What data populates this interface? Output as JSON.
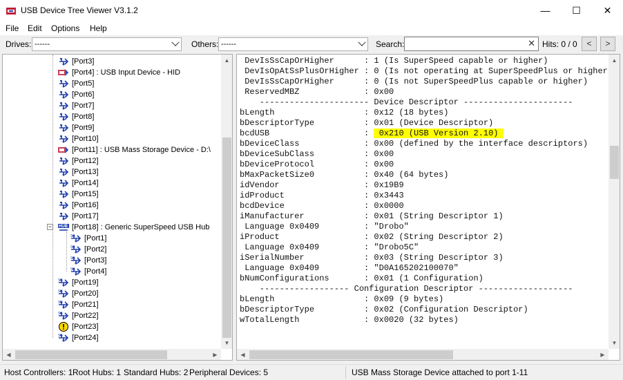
{
  "window": {
    "title": "USB Device Tree Viewer V3.1.2",
    "minimize": "—",
    "maximize": "☐",
    "close": "✕"
  },
  "menu": [
    "File",
    "Edit",
    "Options",
    "Help"
  ],
  "toolbar": {
    "drives_label": "Drives:",
    "drives_value": "------",
    "others_label": "Others:",
    "others_value": "------",
    "search_label": "Search:",
    "search_value": "",
    "search_clear": "✕",
    "hits": "Hits:  0 / 0",
    "prev": "<",
    "next": ">"
  },
  "tree": [
    {
      "label": "[Port3]",
      "icon": "usb-port-icon",
      "depth": 0
    },
    {
      "label": "[Port4] : USB Input Device - HID",
      "icon": "usb-device-icon",
      "depth": 0
    },
    {
      "label": "[Port5]",
      "icon": "usb-port-icon",
      "depth": 0
    },
    {
      "label": "[Port6]",
      "icon": "usb-port-icon",
      "depth": 0
    },
    {
      "label": "[Port7]",
      "icon": "usb-port-icon",
      "depth": 0
    },
    {
      "label": "[Port8]",
      "icon": "usb-port-icon",
      "depth": 0
    },
    {
      "label": "[Port9]",
      "icon": "usb-port-icon",
      "depth": 0
    },
    {
      "label": "[Port10]",
      "icon": "usb-port-icon",
      "depth": 0
    },
    {
      "label": "[Port11] : USB Mass Storage Device - D:\\",
      "icon": "usb-device-icon",
      "depth": 0
    },
    {
      "label": "[Port12]",
      "icon": "usb-port-icon",
      "depth": 0
    },
    {
      "label": "[Port13]",
      "icon": "usb-port-icon",
      "depth": 0
    },
    {
      "label": "[Port14]",
      "icon": "usb-port-icon",
      "depth": 0
    },
    {
      "label": "[Port15]",
      "icon": "usb-port-icon",
      "depth": 0
    },
    {
      "label": "[Port16]",
      "icon": "usb-port-icon",
      "depth": 0
    },
    {
      "label": "[Port17]",
      "icon": "usb-port-icon",
      "depth": 0
    },
    {
      "label": "[Port18] : Generic SuperSpeed USB Hub",
      "icon": "usb-hub-icon",
      "depth": 0
    },
    {
      "label": "[Port1]",
      "icon": "superspeed-port-icon",
      "depth": 1
    },
    {
      "label": "[Port2]",
      "icon": "superspeed-port-icon",
      "depth": 1
    },
    {
      "label": "[Port3]",
      "icon": "superspeed-port-icon",
      "depth": 1
    },
    {
      "label": "[Port4]",
      "icon": "superspeed-port-icon",
      "depth": 1
    },
    {
      "label": "[Port19]",
      "icon": "superspeed-port-icon",
      "depth": 0
    },
    {
      "label": "[Port20]",
      "icon": "superspeed-port-icon",
      "depth": 0
    },
    {
      "label": "[Port21]",
      "icon": "superspeed-port-icon",
      "depth": 0
    },
    {
      "label": "[Port22]",
      "icon": "superspeed-port-icon",
      "depth": 0
    },
    {
      "label": "[Port23]",
      "icon": "warning-icon",
      "depth": 0
    },
    {
      "label": "[Port24]",
      "icon": "superspeed-port-icon",
      "depth": 0
    }
  ],
  "detail_lines": [
    " DevIsSsCapOrHigher      : 1 (Is SuperSpeed capable or higher)",
    " DevIsOpAtSsPlusOrHigher : 0 (Is not operating at SuperSpeedPlus or higher)",
    " DevIsSsCapOrHigher      : 0 (Is not SuperSpeedPlus capable or higher)",
    " ReservedMBZ             : 0x00",
    "",
    "    ---------------------- Device Descriptor ----------------------",
    "bLength                  : 0x12 (18 bytes)",
    "bDescriptorType          : 0x01 (Device Descriptor)",
    "bcdUSB                   : ",
    "bDeviceClass             : 0x00 (defined by the interface descriptors)",
    "bDeviceSubClass          : 0x00",
    "bDeviceProtocol          : 0x00",
    "bMaxPacketSize0          : 0x40 (64 bytes)",
    "idVendor                 : 0x19B9",
    "idProduct                : 0x3443",
    "bcdDevice                : 0x0000",
    "iManufacturer            : 0x01 (String Descriptor 1)",
    " Language 0x0409         : \"Drobo\"",
    "iProduct                 : 0x02 (String Descriptor 2)",
    " Language 0x0409         : \"Drobo5C\"",
    "iSerialNumber            : 0x03 (String Descriptor 3)",
    " Language 0x0409         : \"D0A165202100070\"",
    "bNumConfigurations       : 0x01 (1 Configuration)",
    "",
    "    ------------------ Configuration Descriptor -------------------",
    "bLength                  : 0x09 (9 bytes)",
    "bDescriptorType          : 0x02 (Configuration Descriptor)",
    "wTotalLength             : 0x0020 (32 bytes)"
  ],
  "highlight_value": " 0x210 (USB Version 2.10) ",
  "status": {
    "host_controllers": "Host Controllers: 1",
    "root_hubs": "Root Hubs: 1",
    "standard_hubs": "Standard Hubs: 2",
    "peripheral_devices": "Peripheral Devices: 5",
    "message": "USB Mass Storage Device attached to port 1-11"
  },
  "colors": {
    "highlight": "#ffff00",
    "usb_icon": "#1f3fae",
    "device_icon_red": "#c0203a"
  }
}
